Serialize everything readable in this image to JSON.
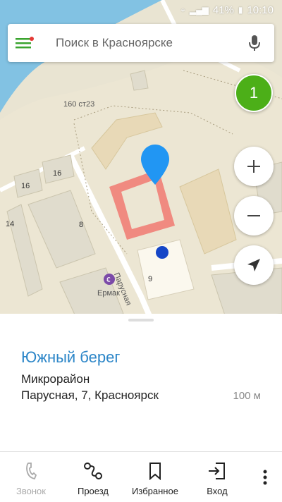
{
  "status_bar": {
    "battery": "41%",
    "time": "10:10"
  },
  "search": {
    "placeholder": "Поиск в Красноярске"
  },
  "map": {
    "badge_count": "1",
    "labels": {
      "street_label": "160 ст23",
      "street_parusnaya": "Парусная",
      "poi_ermak": "Ермак",
      "house_16a": "16",
      "house_16b": "16",
      "house_14": "14",
      "house_8": "8",
      "house_9": "9"
    }
  },
  "place": {
    "title": "Южный берег",
    "type": "Микрорайон",
    "address": "Парусная, 7, Красноярск",
    "distance": "100 м"
  },
  "toolbar": {
    "call": "Звонок",
    "route": "Проезд",
    "favorites": "Избранное",
    "login": "Вход"
  },
  "colors": {
    "accent": "#2c86c8",
    "badge": "#4caf18",
    "pin": "#2196f3",
    "selected_building": "#f08a80"
  }
}
